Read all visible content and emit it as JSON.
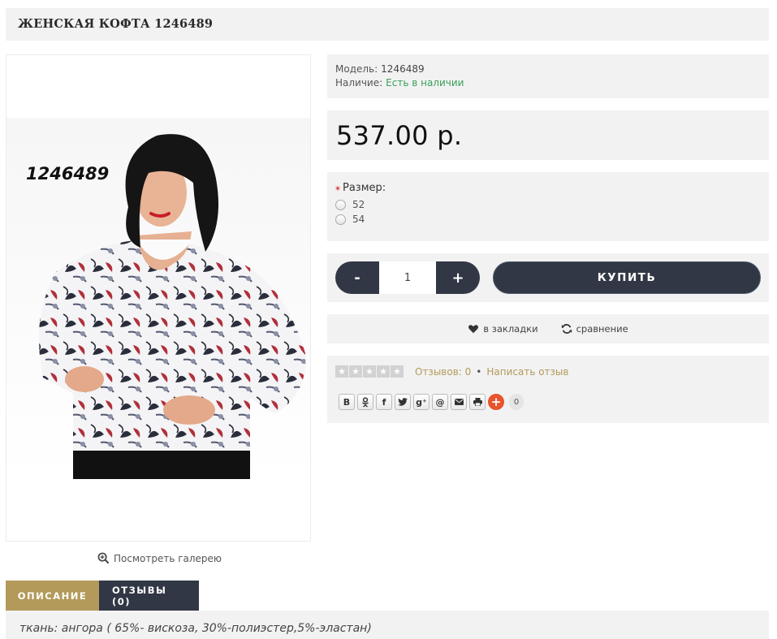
{
  "product": {
    "title": "ЖЕНСКАЯ КОФТА 1246489",
    "photo_code": "1246489",
    "gallery_link": "Посмотреть галерею"
  },
  "info": {
    "model_label": "Модель:",
    "model_value": "1246489",
    "availability_label": "Наличие:",
    "availability_value": "Есть в наличии",
    "availability_color": "#3aa05a"
  },
  "price": "537.00 р.",
  "size": {
    "label": "Размер:",
    "required_mark": "*",
    "options": [
      "52",
      "54"
    ]
  },
  "buy": {
    "minus": "-",
    "plus": "+",
    "quantity": "1",
    "button": "КУПИТЬ"
  },
  "actions": {
    "wishlist": "в закладки",
    "compare": "сравнение"
  },
  "reviews": {
    "count_text": "Отзывов: 0",
    "separator": "•",
    "write": "Написать отзыв",
    "rating": 0,
    "max_rating": 5
  },
  "share": {
    "buttons": [
      "В",
      "ok",
      "f",
      "tw",
      "g+",
      "@",
      "mail",
      "print",
      "+"
    ],
    "count": "0"
  },
  "tabs": [
    {
      "label": "ОПИСАНИЕ"
    },
    {
      "label": "ОТЗЫВЫ (0)"
    }
  ],
  "description": "ткань: ангора ( 65%- вискоза, 30%-полиэстер,5%-эластан)",
  "colors": {
    "accent": "#b39a5a",
    "dark": "#323745",
    "panel": "#f2f2f2"
  }
}
